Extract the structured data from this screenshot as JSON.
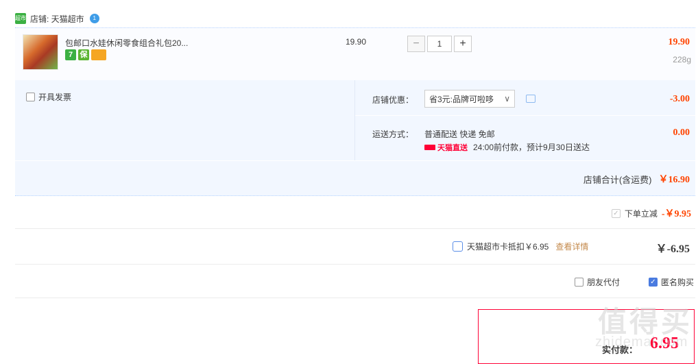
{
  "shop": {
    "icon_text": "超市",
    "name": "店铺: 天猫超市",
    "wangwang_badge": "1"
  },
  "item": {
    "title": "包邮口水娃休闲零食组合礼包20...",
    "unit_price": "19.90",
    "quantity": "1",
    "minus": "−",
    "plus": "+",
    "line_total": "19.90",
    "weight": "228g",
    "badges": [
      {
        "icon": "seven-day-return-icon",
        "text": "7"
      },
      {
        "icon": "guarantee-icon",
        "text": "保"
      },
      {
        "icon": "credit-card-icon",
        "text": ""
      }
    ]
  },
  "options": {
    "invoice_label": "开具发票",
    "promo_label": "店铺优惠：",
    "promo_selected": "省3元:品牌可啦哆",
    "promo_amount": "-3.00",
    "ship_label": "运送方式：",
    "ship_method": "普通配送 快递 免邮",
    "ship_brand": "天猫直送",
    "ship_note": "24:00前付款，预计9月30日送达",
    "ship_amount": "0.00",
    "subtotal_label": "店铺合计(含运费)",
    "subtotal_amount": "￥16.90"
  },
  "discounts": {
    "instant_label": "下单立减",
    "instant_amount": "-￥9.95",
    "card_label": "天猫超市卡抵扣￥6.95",
    "card_link": "查看详情",
    "card_amount": "￥-6.95"
  },
  "purchase": {
    "friend_pay_label": "朋友代付",
    "anonymous_label": "匿名购买"
  },
  "payment": {
    "label": "实付款：",
    "amount": "6.95"
  },
  "watermark": {
    "main": "值得买",
    "sub": "zhidemai.com"
  },
  "colors": {
    "price_red": "#ff4400",
    "accent_red": "#ff0036",
    "light_blue_bg": "#f2f7ff",
    "link_gold": "#c48a4c",
    "check_blue": "#4a7be0"
  }
}
